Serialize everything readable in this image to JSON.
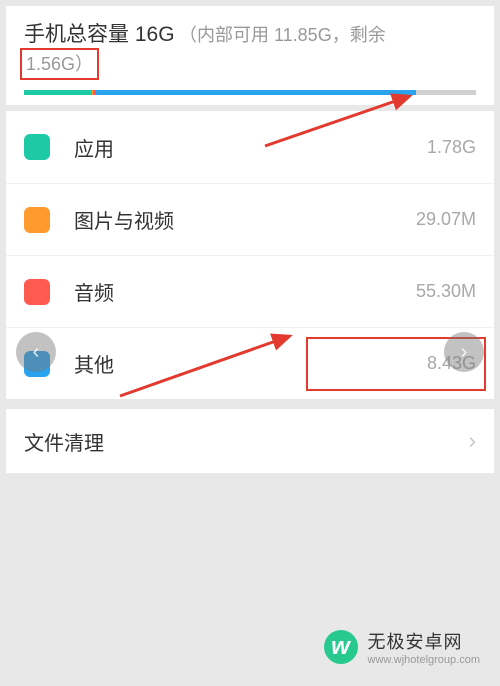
{
  "header": {
    "title": "手机总容量 16G",
    "subtitle": "（内部可用 11.85G，剩余",
    "remaining": "1.56G）"
  },
  "usage": [
    {
      "icon": "apps",
      "label": "应用",
      "value": "1.78G"
    },
    {
      "icon": "media",
      "label": "图片与视频",
      "value": "29.07M"
    },
    {
      "icon": "audio",
      "label": "音频",
      "value": "55.30M"
    },
    {
      "icon": "other",
      "label": "其他",
      "value": "8.43G"
    }
  ],
  "actions": {
    "cleanup": "文件清理"
  },
  "watermark": {
    "brand": "无极安卓网",
    "url": "www.wjhotelgroup.com",
    "glyph": "w"
  },
  "colors": {
    "apps": "#1ec9a6",
    "media": "#ff9a2e",
    "audio": "#ff5a4f",
    "other": "#2aa3ef",
    "highlight": "#e33a2f"
  }
}
